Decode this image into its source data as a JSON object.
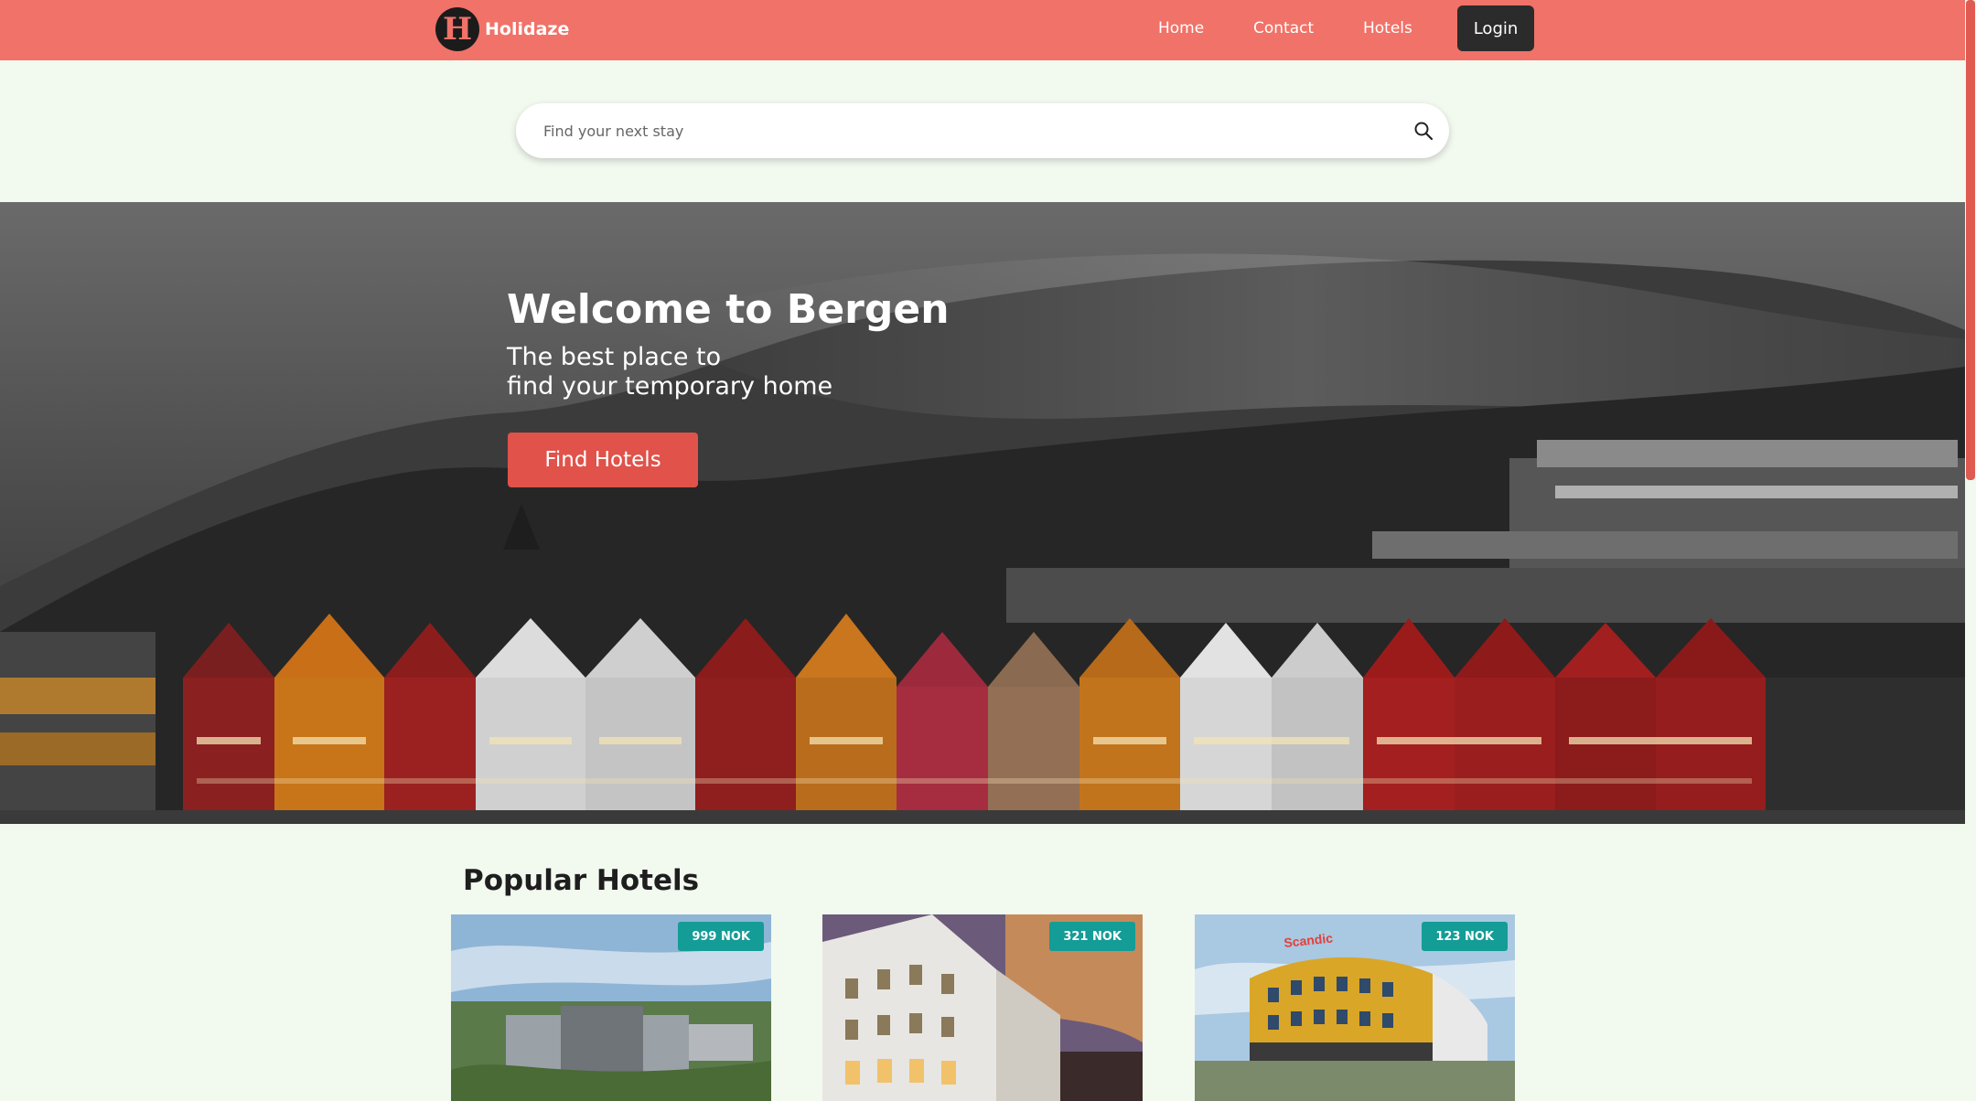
{
  "brand": {
    "name": "Holidaze",
    "logo_letter": "H"
  },
  "nav": {
    "home": "Home",
    "contact": "Contact",
    "hotels": "Hotels",
    "login": "Login"
  },
  "search": {
    "placeholder": "Find your next stay",
    "icon": "search-icon"
  },
  "hero": {
    "title": "Welcome to Bergen",
    "subtitle_line1": "The best place to",
    "subtitle_line2": "find your temporary home",
    "cta": "Find Hotels"
  },
  "popular": {
    "title": "Popular Hotels",
    "hotels": [
      {
        "price": "999 NOK"
      },
      {
        "price": "321 NOK"
      },
      {
        "price": "123 NOK",
        "sign": "Scandic"
      }
    ]
  },
  "colors": {
    "header": "#f07268",
    "cta": "#e0524a",
    "badge": "#149c96",
    "page_bg": "#f2f9ef"
  }
}
